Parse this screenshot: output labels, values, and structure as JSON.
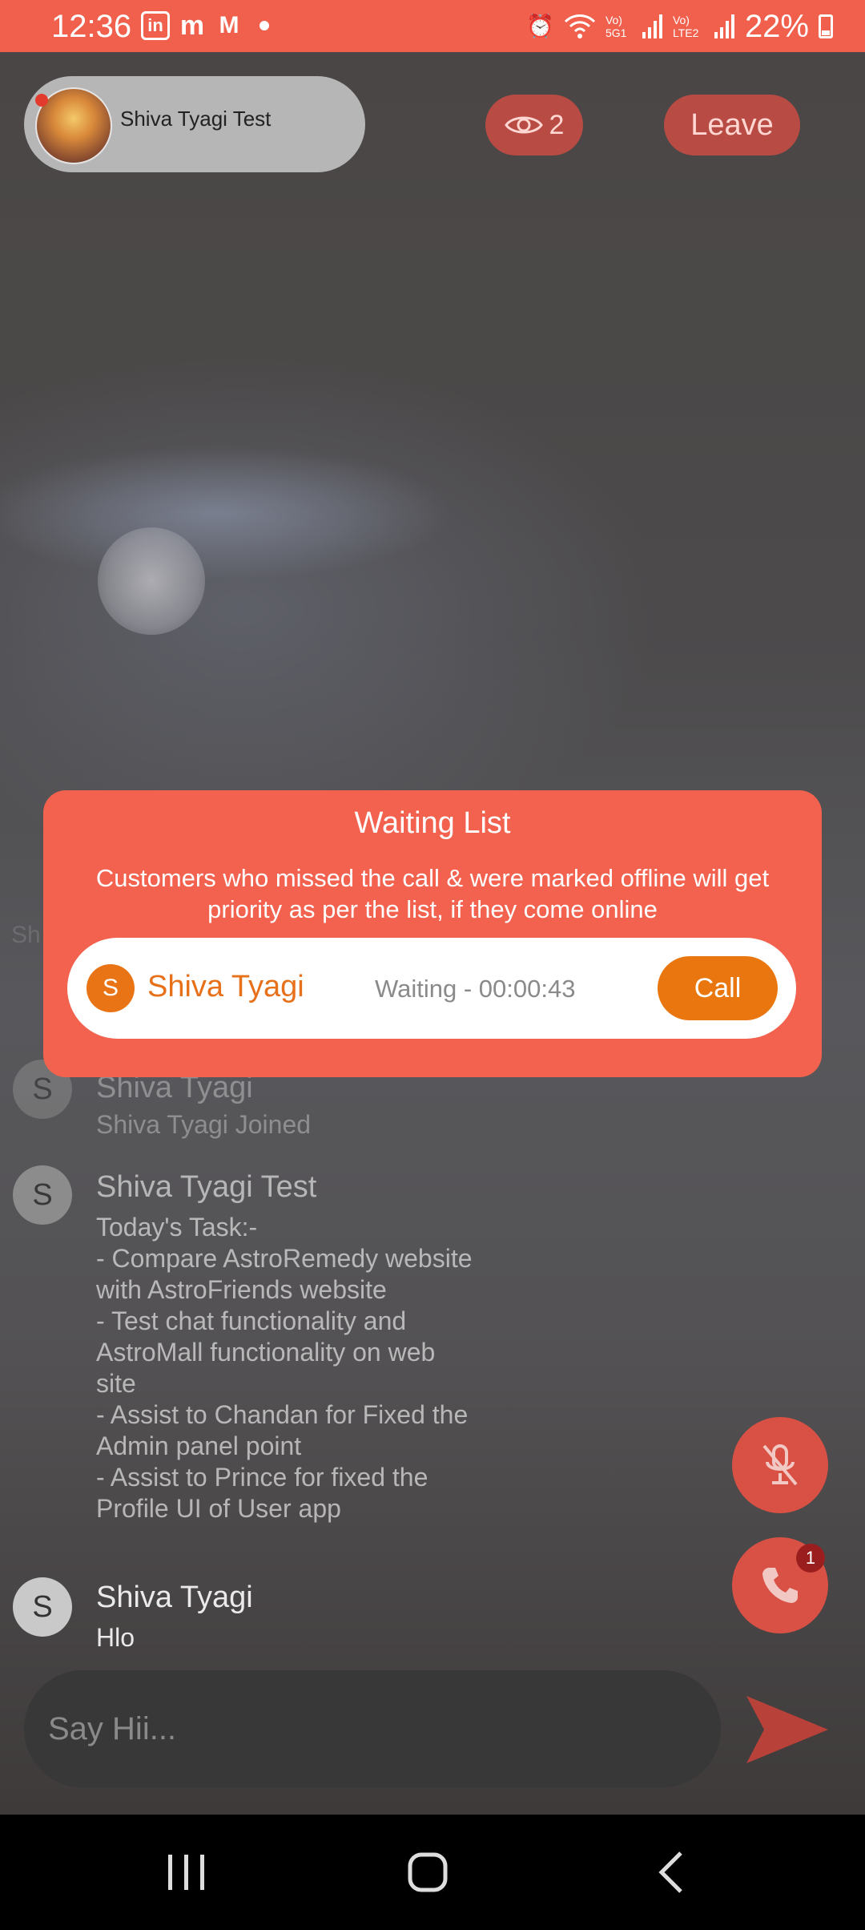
{
  "status_bar": {
    "time": "12:36",
    "apps": [
      "in",
      "m",
      "M"
    ],
    "battery": "22%",
    "signal_1": "Vo) 5G1",
    "signal_2": "Vo) LTE2"
  },
  "header": {
    "host_name": "Shiva Tyagi Test",
    "viewer_count": "2",
    "leave_label": "Leave"
  },
  "partial_text": "Sh",
  "waiting_list": {
    "title": "Waiting List",
    "description": "Customers who missed the call & were marked offline will get priority as per the list, if they come online",
    "entries": [
      {
        "initial": "S",
        "name": "Shiva Tyagi",
        "status": "Waiting - 00:00:43",
        "call_label": "Call"
      }
    ]
  },
  "chat": {
    "messages": [
      {
        "initial": "S",
        "sender": "Shiva Tyagi",
        "text": "Shiva Tyagi Joined"
      },
      {
        "initial": "S",
        "sender": "Shiva Tyagi Test",
        "text": "Today's Task:-\n- Compare AstroRemedy website with AstroFriends website\n- Test chat functionality and AstroMall functionality on web site\n- Assist to Chandan for Fixed the Admin panel point\n- Assist to Prince for fixed the Profile UI of User app"
      },
      {
        "initial": "S",
        "sender": "Shiva Tyagi",
        "text": "Hlo"
      }
    ],
    "input_placeholder": "Say Hii..."
  },
  "call_badge": "1",
  "colors": {
    "accent": "#f2624e",
    "call_button": "#e9760f",
    "fab": "#d95145"
  }
}
